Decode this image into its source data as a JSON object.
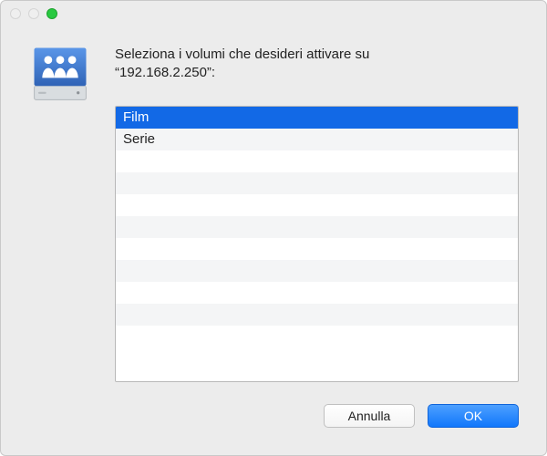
{
  "icon": "network-drive-icon",
  "prompt_line1": "Seleziona i volumi che desideri attivare su",
  "prompt_line2": "“192.168.2.250”:",
  "volumes": [
    {
      "name": "Film",
      "selected": true
    },
    {
      "name": "Serie",
      "selected": false
    }
  ],
  "list_visible_rows": 11,
  "buttons": {
    "cancel": "Annulla",
    "ok": "OK"
  }
}
